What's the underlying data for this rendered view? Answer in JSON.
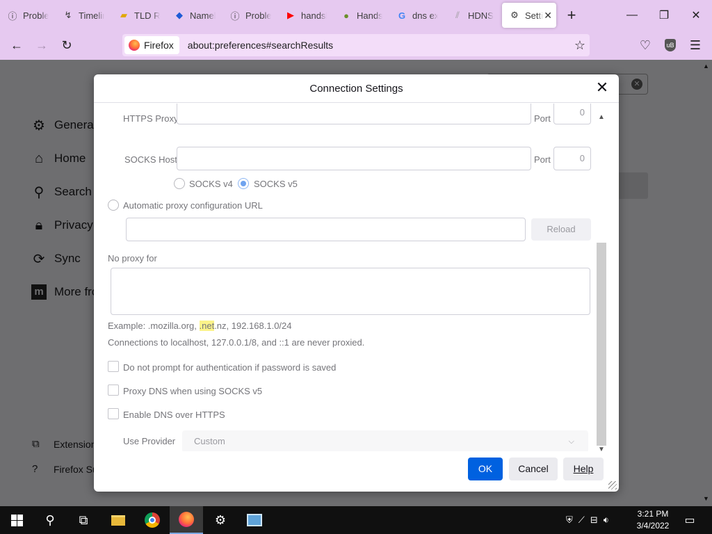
{
  "browser": {
    "tabs": [
      {
        "label": "Problem",
        "icon": "info-icon"
      },
      {
        "label": "Timeline",
        "icon": "timeline-icon"
      },
      {
        "label": "TLD Re",
        "icon": "tld-icon"
      },
      {
        "label": "Namebase",
        "icon": "namebase-icon"
      },
      {
        "label": "Problem",
        "icon": "info-icon"
      },
      {
        "label": "handshake",
        "icon": "youtube-icon"
      },
      {
        "label": "Handshake",
        "icon": "handshake-icon"
      },
      {
        "label": "dns ex",
        "icon": "google-icon"
      },
      {
        "label": "HDNS",
        "icon": "hdns-icon"
      },
      {
        "label": "Settings",
        "icon": "gear-icon"
      }
    ],
    "identity_label": "Firefox",
    "url": "about:preferences#searchResults"
  },
  "sidebar": {
    "items": [
      {
        "label": "General",
        "icon": "gear-icon"
      },
      {
        "label": "Home",
        "icon": "home-icon"
      },
      {
        "label": "Search",
        "icon": "search-icon"
      },
      {
        "label": "Privacy &",
        "icon": "lock-icon"
      },
      {
        "label": "Sync",
        "icon": "sync-icon"
      },
      {
        "label": "More fro",
        "icon": "mozilla-icon"
      }
    ],
    "footer": [
      {
        "label": "Extension",
        "icon": "puzzle-icon"
      },
      {
        "label": "Firefox Su",
        "icon": "help-icon"
      }
    ]
  },
  "dialog": {
    "title": "Connection Settings",
    "https_proxy_label": "HTTPS Proxy",
    "port_label": "Port",
    "https_port": "0",
    "socks_host_label": "SOCKS Host",
    "socks_port": "0",
    "socks_v4": "SOCKS v4",
    "socks_v5": "SOCKS v5",
    "auto_proxy_label": "Automatic proxy configuration URL",
    "reload_label": "Reload",
    "no_proxy_label": "No proxy for",
    "example_prefix": "Example: .mozilla.org, ",
    "example_highlight": ".net",
    "example_suffix": ".nz, 192.168.1.0/24",
    "localhost_note": "Connections to localhost, 127.0.0.1/8, and ::1 are never proxied.",
    "no_prompt_label": "Do not prompt for authentication if password is saved",
    "proxy_dns_label": "Proxy DNS when using SOCKS v5",
    "enable_doh_label": "Enable DNS over HTTPS",
    "use_provider_label": "Use Provider",
    "provider_value": "Custom",
    "ok_label": "OK",
    "cancel_label": "Cancel",
    "help_label": "Help"
  },
  "taskbar": {
    "time": "3:21 PM",
    "date": "3/4/2022"
  },
  "colors": {
    "chrome": "#e6c9f0",
    "primary_button": "#0061e0"
  }
}
